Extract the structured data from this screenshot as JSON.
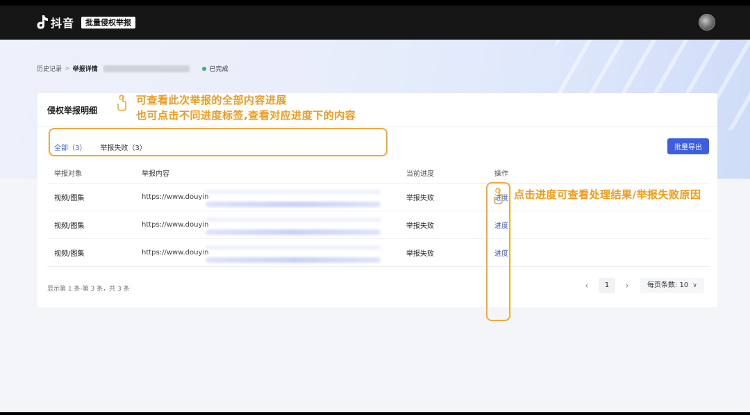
{
  "header": {
    "app_name": "抖音",
    "badge": "批量侵权举报"
  },
  "breadcrumb": {
    "history": "历史记录",
    "separator": ">",
    "current": "举报详情",
    "status": "已完成"
  },
  "card": {
    "title": "侵权举报明细",
    "tabs": [
      {
        "label": "全部（3）",
        "active": true
      },
      {
        "label": "举报失败（3）",
        "active": false
      }
    ],
    "export_button": "批量导出"
  },
  "table": {
    "columns": [
      "举报对象",
      "举报内容",
      "当前进度",
      "操作"
    ],
    "rows": [
      {
        "target": "视频/图集",
        "content": "https://www.douyin",
        "progress": "举报失败",
        "action": "进度"
      },
      {
        "target": "视频/图集",
        "content": "https://www.douyin",
        "progress": "举报失败",
        "action": "进度"
      },
      {
        "target": "视频/图集",
        "content": "https://www.douyin",
        "progress": "举报失败",
        "action": "进度"
      }
    ]
  },
  "footer": {
    "summary": "显示第 1 条-第 3 条，共 3 条",
    "current_page": "1",
    "page_size_label": "每页条数: 10"
  },
  "annotations": {
    "line1": "可查看此次举报的全部内容进展",
    "line2": "也可点击不同进度标签,查看对应进度下的内容",
    "line3": "点击进度可查看处理结果/举报失败原因",
    "color": "#f39a1b"
  },
  "colors": {
    "accent": "#3d5ee1",
    "topbar": "#161616",
    "success": "#3ab26b"
  }
}
